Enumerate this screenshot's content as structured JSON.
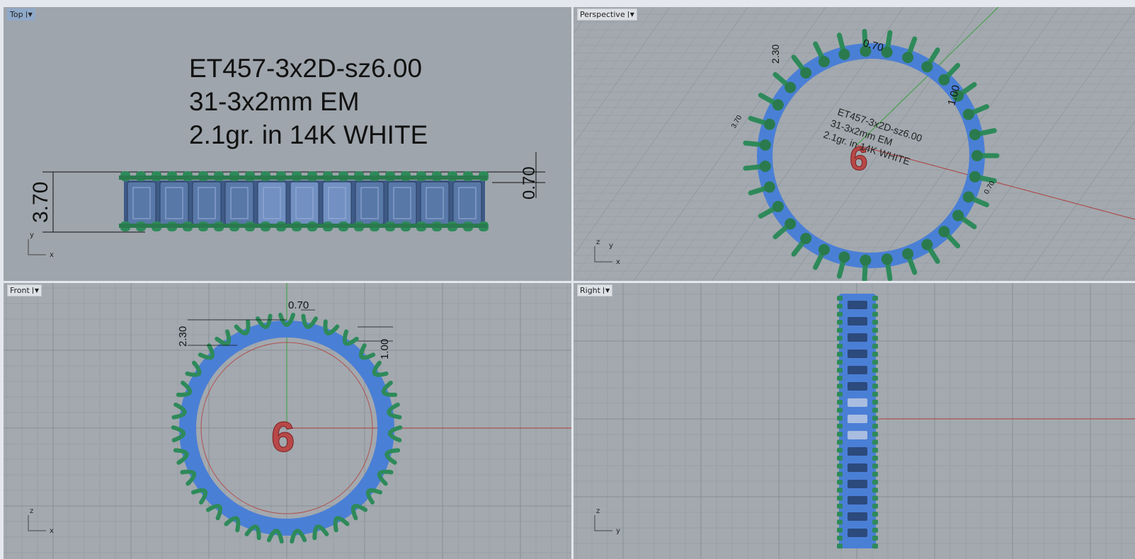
{
  "viewports": {
    "top": {
      "label": "Top",
      "axes": [
        "y",
        "x"
      ]
    },
    "perspective": {
      "label": "Perspective",
      "axes": [
        "z",
        "y",
        "x"
      ]
    },
    "front": {
      "label": "Front",
      "axes": [
        "z",
        "x"
      ]
    },
    "right": {
      "label": "Right",
      "axes": [
        "z",
        "y"
      ]
    }
  },
  "annotation": {
    "lines": [
      "ET457-3x2D-sz6.00",
      "31-3x2mm EM",
      "2.1gr.  in 14K WHITE"
    ]
  },
  "dimensions": {
    "width": "0.70",
    "height_total": "3.70",
    "height_top": "2.30",
    "height_side": "1.00"
  },
  "size_marker": "6",
  "colors": {
    "metal": "#2e8a5a",
    "stone": "#4a7fd6",
    "viewport_bg": "#9ea5ac",
    "grid": "#8f969d",
    "x_axis": "#b03a3a",
    "y_axis": "#3aa03a",
    "marker": "#b84848"
  }
}
